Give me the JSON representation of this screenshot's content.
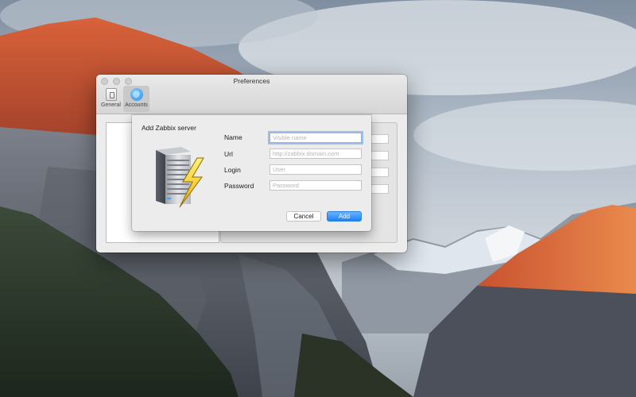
{
  "window": {
    "title": "Preferences",
    "toolbar": {
      "general_label": "General",
      "accounts_label": "Accounts",
      "accounts_icon": "@"
    },
    "list_controls": {
      "add": "+",
      "remove": "−"
    }
  },
  "sheet": {
    "title": "Add Zabbix server",
    "fields": {
      "name_label": "Name",
      "name_placeholder": "Visible name",
      "url_label": "Url",
      "url_placeholder": "http://zabbix.domain.com",
      "login_label": "Login",
      "login_placeholder": "User",
      "password_label": "Password",
      "password_placeholder": "Password"
    },
    "buttons": {
      "cancel": "Cancel",
      "add": "Add"
    }
  },
  "colors": {
    "accent": "#1a82f7",
    "focus_ring": "#609be6"
  },
  "icons": {
    "server": "server-icon",
    "lightning": "lightning-bolt-icon",
    "general": "general-settings-icon",
    "accounts": "at-sign-icon"
  }
}
